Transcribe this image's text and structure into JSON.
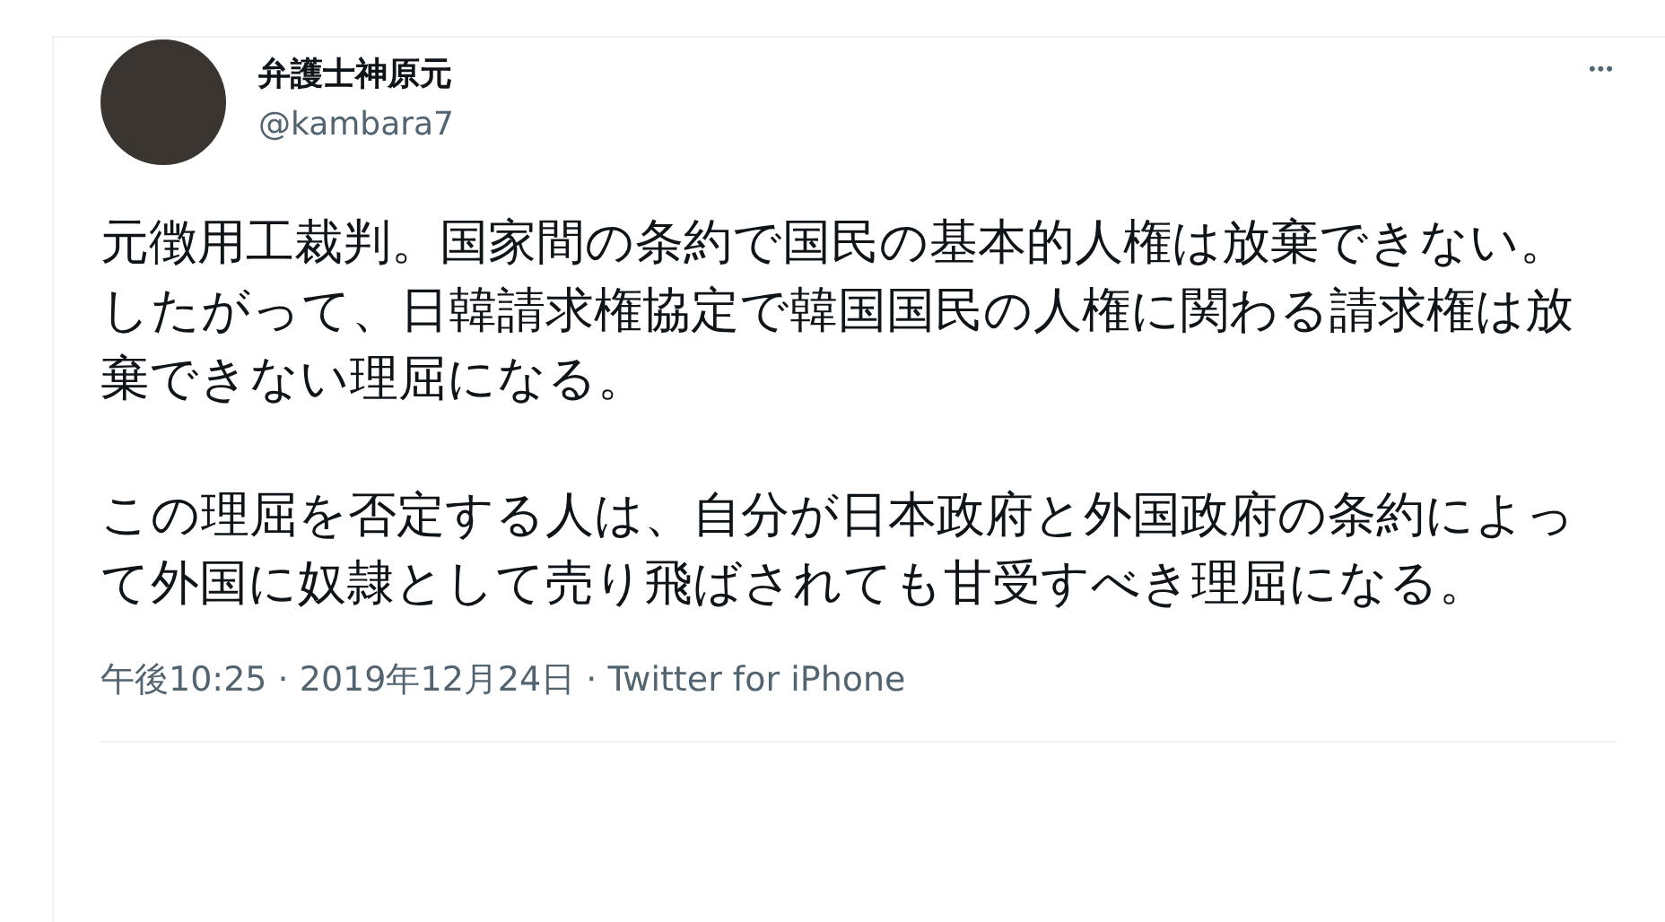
{
  "tweet": {
    "author": {
      "name": "弁護士神原元",
      "handle": "@kambara7"
    },
    "more": "•••",
    "paragraphs": [
      "元徴用工裁判。国家間の条約で国民の基本的人権は放棄できない。したがって、日韓請求権協定で韓国国民の人権に関わる請求権は放棄できない理屈になる。",
      "この理屈を否定する人は、自分が日本政府と外国政府の条約によって外国に奴隷として売り飛ばされても甘受すべき理屈になる。"
    ],
    "meta": "午後10:25 · 2019年12月24日 · Twitter for iPhone"
  }
}
